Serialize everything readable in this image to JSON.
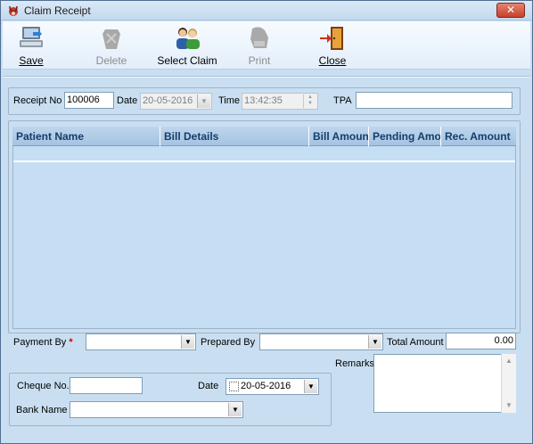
{
  "window": {
    "title": "Claim Receipt",
    "close_glyph": "✕"
  },
  "toolbar": {
    "save": "Save",
    "delete": "Delete",
    "select_claim": "Select Claim",
    "print": "Print",
    "close": "Close"
  },
  "header": {
    "receipt_no_label": "Receipt No",
    "receipt_no_value": "100006",
    "date_label": "Date",
    "date_value": "20-05-2016",
    "time_label": "Time",
    "time_value": "13:42:35",
    "tpa_label": "TPA",
    "tpa_value": ""
  },
  "grid": {
    "columns": [
      "Patient Name",
      "Bill Details",
      "Bill Amount",
      "Pending Amount",
      "Rec. Amount"
    ]
  },
  "footer": {
    "payment_by_label": "Payment By",
    "required_mark": "*",
    "payment_by_value": "",
    "prepared_by_label": "Prepared By",
    "prepared_by_value": "",
    "total_amount_label": "Total Amount",
    "total_amount_value": "0.00",
    "remarks_label": "Remarks",
    "remarks_value": "",
    "cheque_no_label": "Cheque No.",
    "cheque_no_value": "",
    "cheque_date_label": "Date",
    "cheque_date_value": "20-05-2016",
    "bank_name_label": "Bank Name",
    "bank_name_value": ""
  },
  "icons": {
    "app": "stethoscope-icon",
    "save": "save-computer-icon",
    "delete": "delete-icon",
    "select_claim": "users-icon",
    "print": "print-icon",
    "close": "exit-door-icon"
  }
}
